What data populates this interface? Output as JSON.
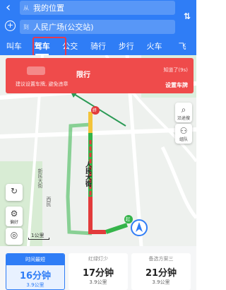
{
  "header": {
    "from_prefix": "从",
    "from_value": "我的位置",
    "to_prefix": "到",
    "to_value": "人民广场(公交站)",
    "swap_icon": "swap-arrows-icon",
    "add_icon": "plus-circle-icon"
  },
  "tabs": [
    "叫车",
    "驾车",
    "公交",
    "骑行",
    "步行",
    "火车",
    "飞"
  ],
  "active_tab": "驾车",
  "banner": {
    "title": "限行",
    "message": "建议设置车牌, 避免违章",
    "know": "知道了(9s)",
    "set_plate": "设置车牌"
  },
  "map": {
    "start_marker": "起",
    "end_marker": "终",
    "road_label": "人民大街",
    "place_label_1": "新民大街",
    "place_label_2": "西民",
    "controls_right": [
      {
        "label": "沿途搜",
        "icon": "search-along-icon"
      },
      {
        "label": "组队",
        "icon": "team-icon"
      }
    ],
    "prefs_label": "偏好",
    "scale": "1公里"
  },
  "routes": [
    {
      "tag": "时间最短",
      "time": "16分钟",
      "distance": "3.9公里"
    },
    {
      "tag": "红绿灯少",
      "time": "17分钟",
      "distance": "3.9公里"
    },
    {
      "tag": "备选方案三",
      "time": "21分钟",
      "distance": "3.9公里"
    }
  ],
  "colors": {
    "brand": "#2f7df6",
    "alert": "#ef4b4b",
    "traffic_green": "#35b44a",
    "traffic_red": "#e23b3b",
    "traffic_yellow": "#f3c43a"
  }
}
